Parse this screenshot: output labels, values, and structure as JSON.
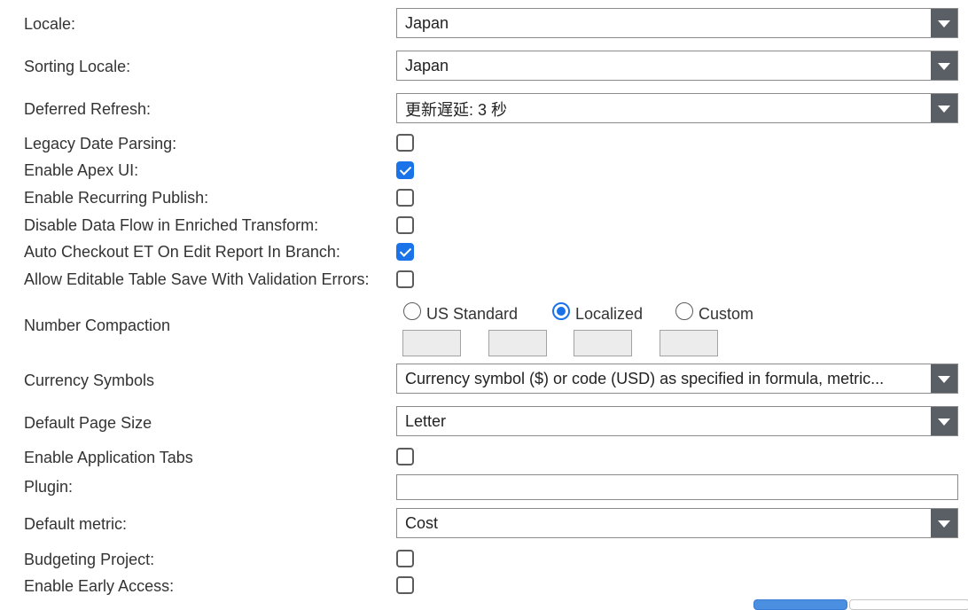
{
  "settings": {
    "locale": {
      "label": "Locale:",
      "value": "Japan"
    },
    "sorting_locale": {
      "label": "Sorting Locale:",
      "value": "Japan"
    },
    "deferred_refresh": {
      "label": "Deferred Refresh:",
      "value": "更新遅延: 3 秒"
    },
    "legacy_date_parsing": {
      "label": "Legacy Date Parsing:",
      "checked": false
    },
    "enable_apex_ui": {
      "label": "Enable Apex UI:",
      "checked": true
    },
    "enable_recurring_publish": {
      "label": "Enable Recurring Publish:",
      "checked": false
    },
    "disable_data_flow": {
      "label": "Disable Data Flow in Enriched Transform:",
      "checked": false
    },
    "auto_checkout_et": {
      "label": "Auto Checkout ET On Edit Report In Branch:",
      "checked": true
    },
    "allow_editable_table_save": {
      "label": "Allow Editable Table Save With Validation Errors:",
      "checked": false
    },
    "number_compaction": {
      "label": "Number Compaction",
      "options": [
        "US Standard",
        "Localized",
        "Custom"
      ],
      "selected": "Localized",
      "custom_fields": [
        "",
        "",
        "",
        ""
      ]
    },
    "currency_symbols": {
      "label": "Currency Symbols",
      "value": "Currency symbol ($) or code (USD) as specified in formula, metric..."
    },
    "default_page_size": {
      "label": "Default Page Size",
      "value": "Letter"
    },
    "enable_application_tabs": {
      "label": "Enable Application Tabs",
      "checked": false
    },
    "plugin": {
      "label": "Plugin:",
      "value": ""
    },
    "default_metric": {
      "label": "Default metric:",
      "value": "Cost"
    },
    "budgeting_project": {
      "label": "Budgeting Project:",
      "checked": false
    },
    "enable_early_access": {
      "label": "Enable Early Access:",
      "checked": false
    }
  },
  "colors": {
    "accent": "#1a73e8",
    "dropdown_arrow_bg": "#5a5f66"
  }
}
